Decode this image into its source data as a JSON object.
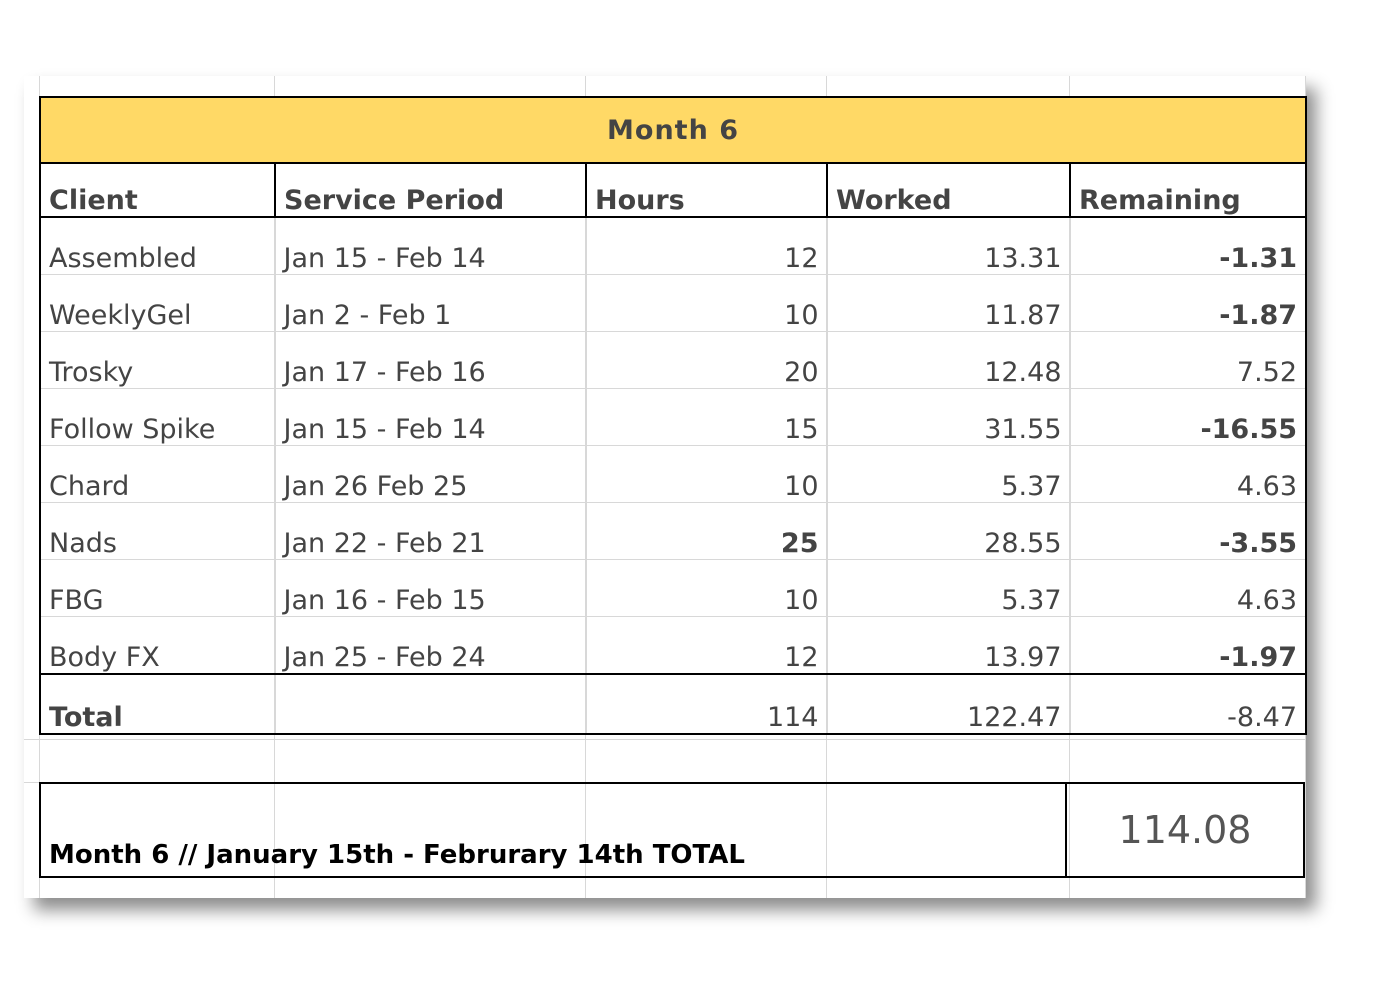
{
  "title": "Month 6",
  "headers": [
    "Client",
    "Service Period",
    "Hours",
    "Worked",
    "Remaining"
  ],
  "rows": [
    {
      "client": "Assembled",
      "period": "Jan 15 - Feb 14",
      "hours": "12",
      "worked": "13.31",
      "remaining": "-1.31",
      "negative": true
    },
    {
      "client": "WeeklyGel",
      "period": "Jan 2 - Feb 1",
      "hours": "10",
      "worked": "11.87",
      "remaining": "-1.87",
      "negative": true
    },
    {
      "client": "Trosky",
      "period": "Jan 17 - Feb 16",
      "hours": "20",
      "worked": "12.48",
      "remaining": "7.52",
      "negative": false
    },
    {
      "client": "Follow Spike",
      "period": "Jan 15 - Feb 14",
      "hours": "15",
      "worked": "31.55",
      "remaining": "-16.55",
      "negative": true
    },
    {
      "client": "Chard",
      "period": "Jan 26   Feb 25",
      "hours": "10",
      "worked": "5.37",
      "remaining": "4.63",
      "negative": false
    },
    {
      "client": "Nads",
      "period": "Jan 22 - Feb 21",
      "hours": "25",
      "hours_highlight": true,
      "worked": "28.55",
      "remaining": "-3.55",
      "negative": true
    },
    {
      "client": "FBG",
      "period": "Jan 16 - Feb 15",
      "hours": "10",
      "worked": "5.37",
      "remaining": "4.63",
      "negative": false
    },
    {
      "client": "Body FX",
      "period": "Jan 25 - Feb 24",
      "hours": "12",
      "worked": "13.97",
      "remaining": "-1.97",
      "negative": true
    }
  ],
  "total": {
    "label": "Total",
    "period": "",
    "hours": "114",
    "worked": "122.47",
    "remaining": "-8.47"
  },
  "summary": {
    "label": "Month 6 // January 15th - Februrary 14th TOTAL",
    "value": "114.08"
  },
  "colors": {
    "title_bg": "#ffd966",
    "negative": "#ff0000",
    "highlight": "#f28c28"
  }
}
